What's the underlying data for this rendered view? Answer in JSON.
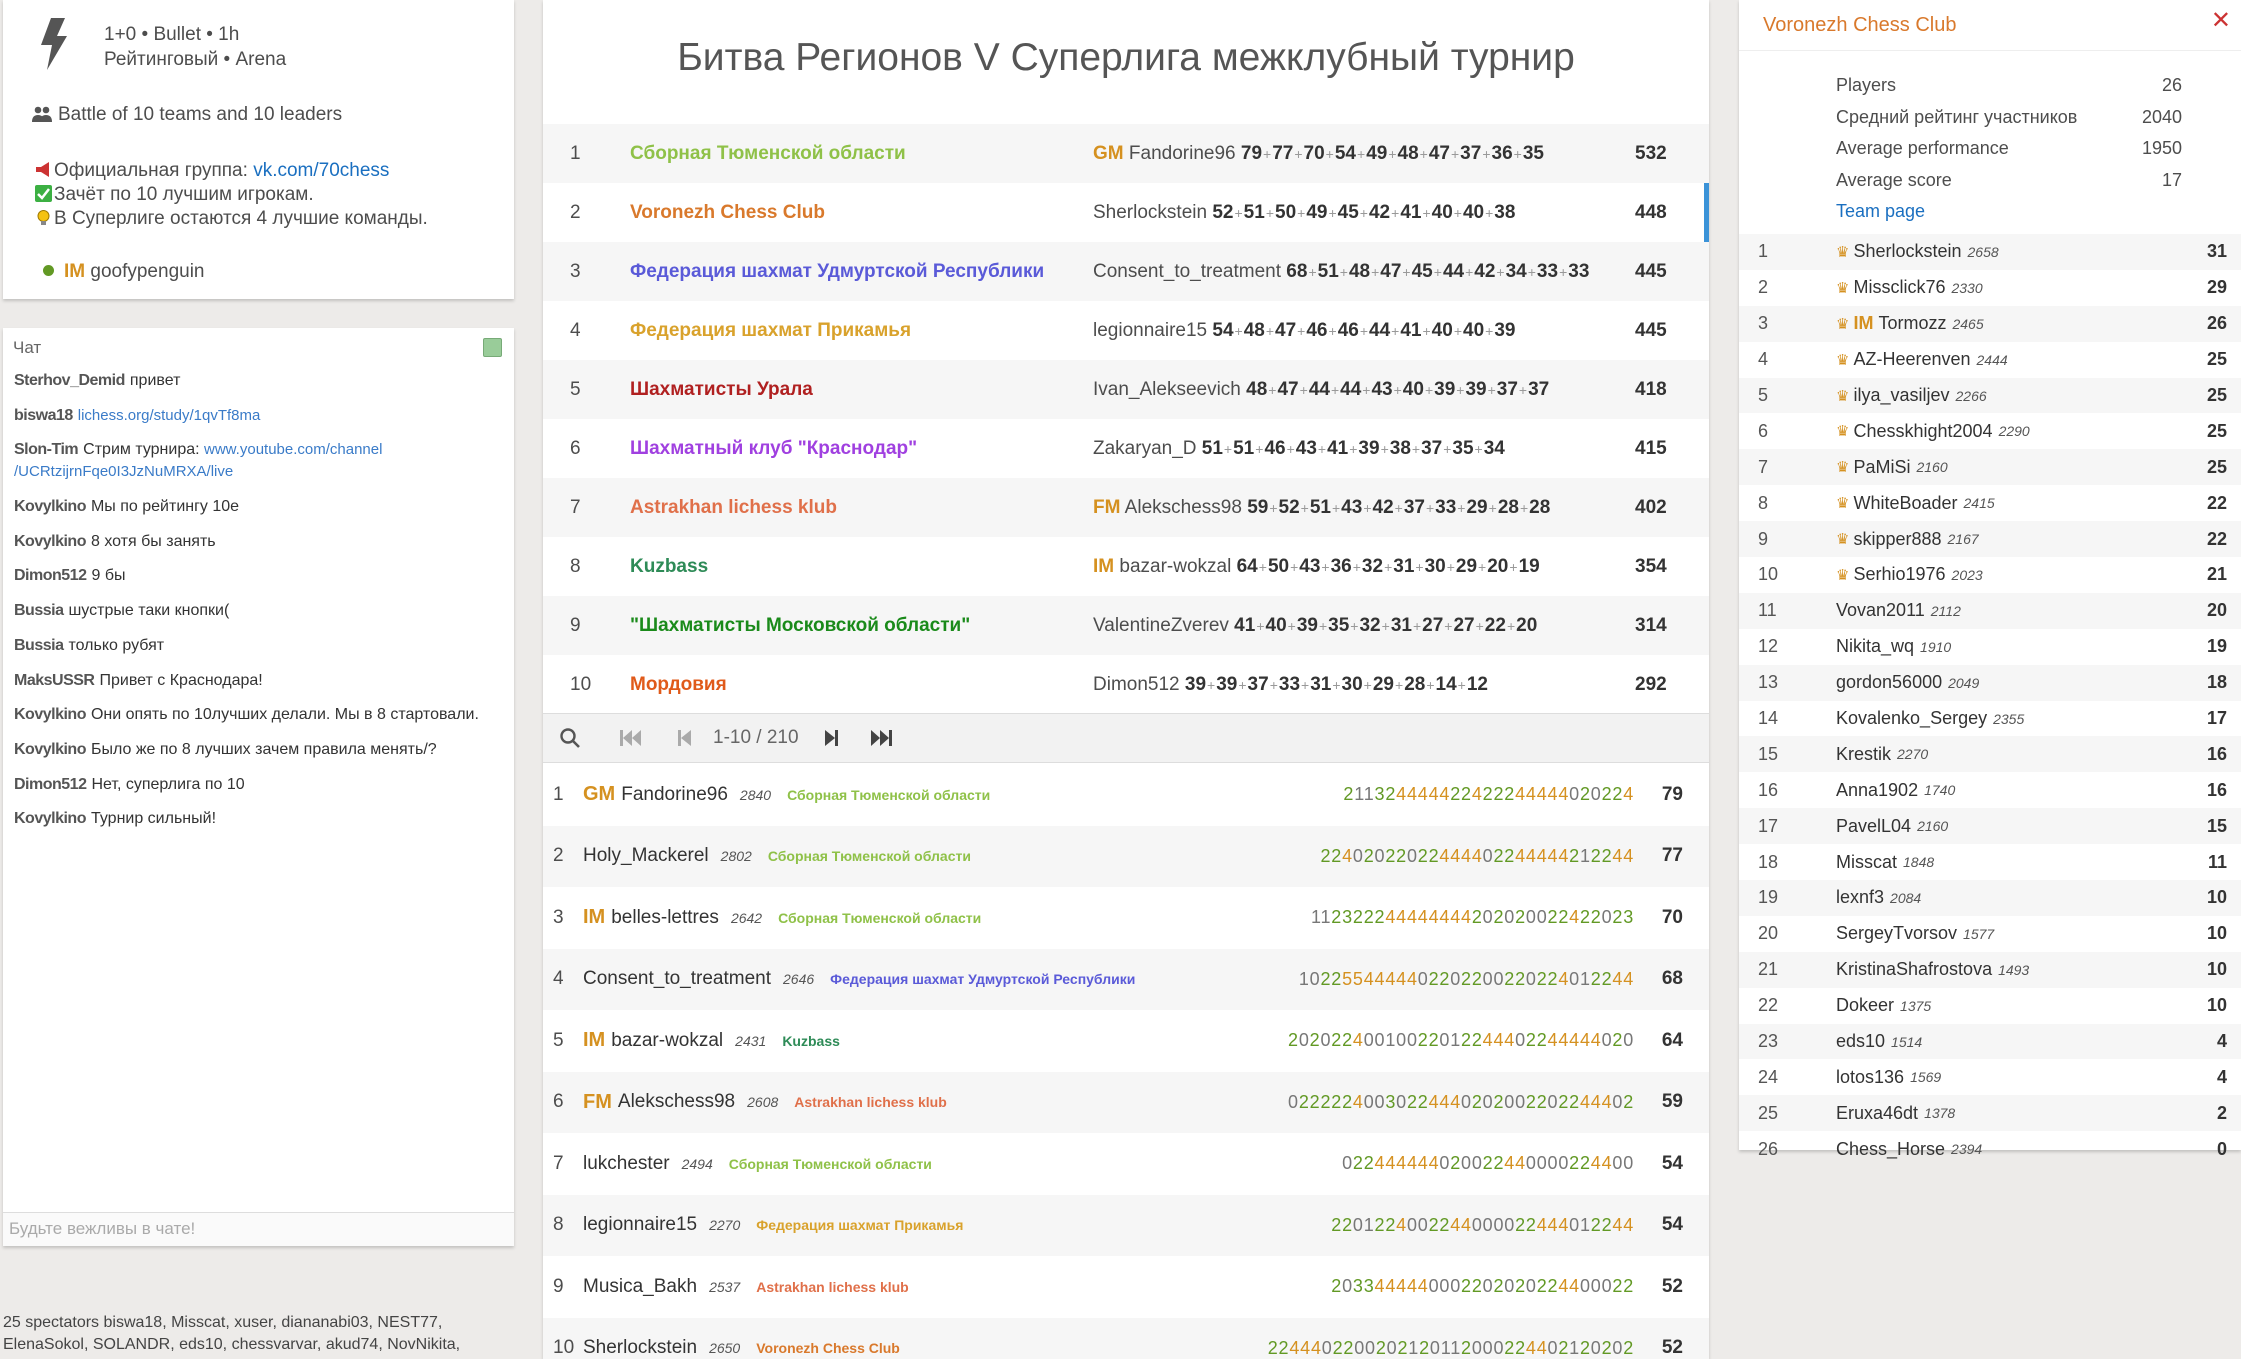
{
  "info": {
    "clock": "1+0 • Bullet • 1h",
    "type": "Рейтинговый • Arena",
    "teams_line": "Battle of 10 teams and 10 leaders",
    "desc1_pre": "Официальная группа: ",
    "desc1_link": "vk.com/70chess",
    "desc2": "Зачёт по 10 лучшим игрокам.",
    "desc3": "В Суперлиге остаются 4 лучшие команды.",
    "creator_title": "IM",
    "creator": "goofypenguin"
  },
  "chat": {
    "title": "Чат",
    "placeholder": "Будьте вежливы в чате!",
    "messages": [
      {
        "user": "Sterhov_Demid",
        "text": "привет"
      },
      {
        "user": "biswa18",
        "link": "lichess.org/study/1qvTf8ma"
      },
      {
        "user": "Slon-Tim",
        "text": "Стрим турнира:",
        "link": "www.youtube.com/channel /UCRtzijrnFqe0I3JzNuMRXA/live"
      },
      {
        "user": "Kovylkino",
        "text": "Мы по рейтингу 10е"
      },
      {
        "user": "Kovylkino",
        "text": "8 хотя бы занять"
      },
      {
        "user": "Dimon512",
        "text": "9 бы"
      },
      {
        "user": "Bussia",
        "text": "шустрые таки кнопки("
      },
      {
        "user": "Bussia",
        "text": "только рубят"
      },
      {
        "user": "MaksUSSR",
        "text": "Привет с Краснодара!"
      },
      {
        "user": "Kovylkino",
        "text": "Они опять по 10лучших делали. Мы в 8 стартовали."
      },
      {
        "user": "Kovylkino",
        "text": "Было же по 8 лучших зачем правила менять/?"
      },
      {
        "user": "Dimon512",
        "text": "Нет, суперлига по 10"
      },
      {
        "user": "Kovylkino",
        "text": "Турнир сильный!"
      }
    ]
  },
  "spectators": "25 spectators biswa18, Misscat, xuser, diananabi03, NEST77, ElenaSokol, SOLANDR, eds10, chessvarvar, akud74, NovNikita,",
  "main": {
    "title": "Битва Регионов V Суперлига межклубный турнир",
    "teams": [
      {
        "rank": "1",
        "name": "Сборная Тюменской области",
        "color": "#8fc148",
        "title": "GM",
        "leader": "Fandorine96",
        "scores": [
          "79",
          "77",
          "70",
          "54",
          "49",
          "48",
          "47",
          "37",
          "36",
          "35"
        ],
        "total": "532"
      },
      {
        "rank": "2",
        "name": "Voronezh Chess Club",
        "color": "#d9792c",
        "title": "",
        "leader": "Sherlockstein",
        "scores": [
          "52",
          "51",
          "50",
          "49",
          "45",
          "42",
          "41",
          "40",
          "40",
          "38"
        ],
        "total": "448"
      },
      {
        "rank": "3",
        "name": "Федерация шахмат Удмуртской Республики",
        "color": "#5a5ad8",
        "title": "",
        "leader": "Consent_to_treatment",
        "scores": [
          "68",
          "51",
          "48",
          "47",
          "45",
          "44",
          "42",
          "34",
          "33",
          "33"
        ],
        "total": "445"
      },
      {
        "rank": "4",
        "name": "Федерация шахмат Прикамья",
        "color": "#d9a22c",
        "title": "",
        "leader": "legionnaire15",
        "scores": [
          "54",
          "48",
          "47",
          "46",
          "46",
          "44",
          "41",
          "40",
          "40",
          "39"
        ],
        "total": "445"
      },
      {
        "rank": "5",
        "name": "Шахматисты Урала",
        "color": "#b02020",
        "title": "",
        "leader": "Ivan_Alekseevich",
        "scores": [
          "48",
          "47",
          "44",
          "44",
          "43",
          "40",
          "39",
          "39",
          "37",
          "37"
        ],
        "total": "418"
      },
      {
        "rank": "6",
        "name": "Шахматный клуб \"Краснодар\"",
        "color": "#a040e0",
        "title": "",
        "leader": "Zakaryan_D",
        "scores": [
          "51",
          "51",
          "46",
          "43",
          "41",
          "39",
          "38",
          "37",
          "35",
          "34"
        ],
        "total": "415"
      },
      {
        "rank": "7",
        "name": "Astrakhan lichess klub",
        "color": "#e0704a",
        "title": "FM",
        "leader": "Alekschess98",
        "scores": [
          "59",
          "52",
          "51",
          "43",
          "42",
          "37",
          "33",
          "29",
          "28",
          "28"
        ],
        "total": "402"
      },
      {
        "rank": "8",
        "name": "Kuzbass",
        "color": "#2e8b57",
        "title": "IM",
        "leader": "bazar-wokzal",
        "scores": [
          "64",
          "50",
          "43",
          "36",
          "32",
          "31",
          "30",
          "29",
          "20",
          "19"
        ],
        "total": "354"
      },
      {
        "rank": "9",
        "name": "\"Шахматисты Московской области\"",
        "color": "#1a8a1a",
        "title": "",
        "leader": "ValentineZverev",
        "scores": [
          "41",
          "40",
          "39",
          "35",
          "32",
          "31",
          "27",
          "27",
          "22",
          "20"
        ],
        "total": "314"
      },
      {
        "rank": "10",
        "name": "Мордовия",
        "color": "#e05a1a",
        "title": "",
        "leader": "Dimon512",
        "scores": [
          "39",
          "39",
          "37",
          "33",
          "31",
          "30",
          "29",
          "28",
          "14",
          "12"
        ],
        "total": "292"
      }
    ],
    "pager": "1-10 / 210",
    "players": [
      {
        "rank": "1",
        "title": "GM",
        "name": "Fandorine96",
        "rating": "2840",
        "team": "Сборная Тюменской области",
        "tcolor": "#8fc148",
        "sheet": "211324444422422244444020224",
        "score": "79"
      },
      {
        "rank": "2",
        "title": "",
        "name": "Holy_Mackerel",
        "rating": "2802",
        "team": "Сборная Тюменской области",
        "tcolor": "#8fc148",
        "sheet": "2240202202244440224444421224 4",
        "score": "77"
      },
      {
        "rank": "3",
        "title": "IM",
        "name": "belles-lettres",
        "rating": "2642",
        "team": "Сборная Тюменской области",
        "tcolor": "#8fc148",
        "sheet": "11232224444444420202002242 2023",
        "score": "70"
      },
      {
        "rank": "4",
        "title": "",
        "name": "Consent_to_treatment",
        "rating": "2646",
        "team": "Федерация шахмат Удмуртской Республики",
        "tcolor": "#5a5ad8",
        "sheet": "1022554444402202200220224012244",
        "score": "68"
      },
      {
        "rank": "5",
        "title": "IM",
        "name": "bazar-wokzal",
        "rating": "2431",
        "team": "Kuzbass",
        "tcolor": "#2e8b57",
        "sheet": "2020224001002201224440224444 4020",
        "score": "64"
      },
      {
        "rank": "6",
        "title": "FM",
        "name": "Alekschess98",
        "rating": "2608",
        "team": "Astrakhan lichess klub",
        "tcolor": "#e0704a",
        "sheet": "022222400302244402020022022 44402",
        "score": "59"
      },
      {
        "rank": "7",
        "title": "",
        "name": "lukchester",
        "rating": "2494",
        "team": "Сборная Тюменской области",
        "tcolor": "#8fc148",
        "sheet": "022444444020022440000224400",
        "score": "54"
      },
      {
        "rank": "8",
        "title": "",
        "name": "legionnaire15",
        "rating": "2270",
        "team": "Федерация шахмат Прикамья",
        "tcolor": "#d9a22c",
        "sheet": "2201224002244000022444012244",
        "score": "54"
      },
      {
        "rank": "9",
        "title": "",
        "name": "Musica_Bakh",
        "rating": "2537",
        "team": "Astrakhan lichess klub",
        "tcolor": "#e0704a",
        "sheet": "2033444440002202020224400022",
        "score": "52"
      },
      {
        "rank": "10",
        "title": "",
        "name": "Sherlockstein",
        "rating": "2650",
        "team": "Voronezh Chess Club",
        "tcolor": "#d9792c",
        "sheet": "22444022002021201120002244021 20202",
        "score": "52"
      }
    ]
  },
  "team": {
    "name": "Voronezh Chess Club",
    "stats": [
      {
        "k": "Players",
        "v": "26"
      },
      {
        "k": "Средний рейтинг участников",
        "v": "2040"
      },
      {
        "k": "Average performance",
        "v": "1950"
      },
      {
        "k": "Average score",
        "v": "17"
      }
    ],
    "team_page": "Team page",
    "members": [
      {
        "r": "1",
        "crown": true,
        "title": "",
        "n": "Sherlockstein",
        "ra": "2658",
        "s": "31"
      },
      {
        "r": "2",
        "crown": true,
        "title": "",
        "n": "Missclick76",
        "ra": "2330",
        "s": "29"
      },
      {
        "r": "3",
        "crown": true,
        "title": "IM",
        "n": "Tormozz",
        "ra": "2465",
        "s": "26"
      },
      {
        "r": "4",
        "crown": true,
        "title": "",
        "n": "AZ-Heerenven",
        "ra": "2444",
        "s": "25"
      },
      {
        "r": "5",
        "crown": true,
        "title": "",
        "n": "ilya_vasiljev",
        "ra": "2266",
        "s": "25"
      },
      {
        "r": "6",
        "crown": true,
        "title": "",
        "n": "Chesskhight2004",
        "ra": "2290",
        "s": "25"
      },
      {
        "r": "7",
        "crown": true,
        "title": "",
        "n": "PaMiSi",
        "ra": "2160",
        "s": "25"
      },
      {
        "r": "8",
        "crown": true,
        "title": "",
        "n": "WhiteBoader",
        "ra": "2415",
        "s": "22"
      },
      {
        "r": "9",
        "crown": true,
        "title": "",
        "n": "skipper888",
        "ra": "2167",
        "s": "22"
      },
      {
        "r": "10",
        "crown": true,
        "title": "",
        "n": "Serhio1976",
        "ra": "2023",
        "s": "21"
      },
      {
        "r": "11",
        "crown": false,
        "title": "",
        "n": "Vovan2011",
        "ra": "2112",
        "s": "20"
      },
      {
        "r": "12",
        "crown": false,
        "title": "",
        "n": "Nikita_wq",
        "ra": "1910",
        "s": "19"
      },
      {
        "r": "13",
        "crown": false,
        "title": "",
        "n": "gordon56000",
        "ra": "2049",
        "s": "18"
      },
      {
        "r": "14",
        "crown": false,
        "title": "",
        "n": "Kovalenko_Sergey",
        "ra": "2355",
        "s": "17"
      },
      {
        "r": "15",
        "crown": false,
        "title": "",
        "n": "Krestik",
        "ra": "2270",
        "s": "16"
      },
      {
        "r": "16",
        "crown": false,
        "title": "",
        "n": "Anna1902",
        "ra": "1740",
        "s": "16"
      },
      {
        "r": "17",
        "crown": false,
        "title": "",
        "n": "PavelL04",
        "ra": "2160",
        "s": "15"
      },
      {
        "r": "18",
        "crown": false,
        "title": "",
        "n": "Misscat",
        "ra": "1848",
        "s": "11"
      },
      {
        "r": "19",
        "crown": false,
        "title": "",
        "n": "lexnf3",
        "ra": "2084",
        "s": "10"
      },
      {
        "r": "20",
        "crown": false,
        "title": "",
        "n": "SergeyTvorsov",
        "ra": "1577",
        "s": "10"
      },
      {
        "r": "21",
        "crown": false,
        "title": "",
        "n": "KristinaShafrostova",
        "ra": "1493",
        "s": "10"
      },
      {
        "r": "22",
        "crown": false,
        "title": "",
        "n": "Dokeer",
        "ra": "1375",
        "s": "10"
      },
      {
        "r": "23",
        "crown": false,
        "title": "",
        "n": "eds10",
        "ra": "1514",
        "s": "4"
      },
      {
        "r": "24",
        "crown": false,
        "title": "",
        "n": "lotos136",
        "ra": "1569",
        "s": "4"
      },
      {
        "r": "25",
        "crown": false,
        "title": "",
        "n": "Eruxa46dt",
        "ra": "1378",
        "s": "2"
      },
      {
        "r": "26",
        "crown": false,
        "title": "",
        "n": "Chess_Horse",
        "ra": "2394",
        "s": "0"
      }
    ]
  }
}
